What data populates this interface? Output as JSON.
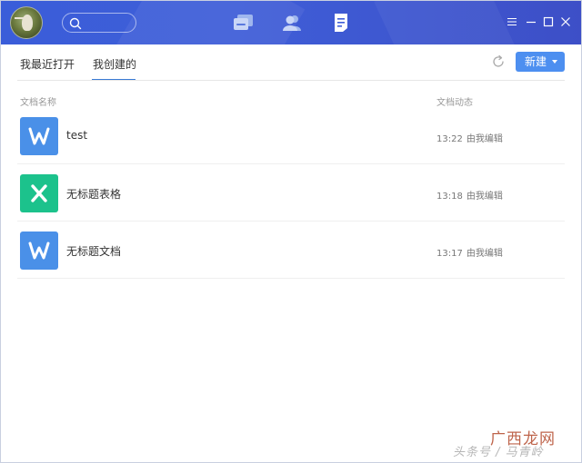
{
  "header": {
    "avatar_icon": "user-avatar-bird",
    "search_icon": "search-icon",
    "nav": [
      {
        "name": "chat",
        "icon": "chat-icon"
      },
      {
        "name": "contacts",
        "icon": "contacts-icon"
      },
      {
        "name": "documents",
        "icon": "document-icon",
        "active": true
      }
    ],
    "window_controls": [
      "menu-icon",
      "minimize-icon",
      "maximize-icon",
      "close-icon"
    ],
    "colors": {
      "header_bg": "#3a5dd9",
      "accent": "#4d8ff0"
    }
  },
  "tabs": [
    {
      "label": "我最近打开",
      "active": false
    },
    {
      "label": "我创建的",
      "active": true
    }
  ],
  "toolbar": {
    "refresh_icon": "refresh-icon",
    "new_button_label": "新建"
  },
  "columns": {
    "name": "文档名称",
    "activity": "文档动态"
  },
  "files": [
    {
      "name": "test",
      "type": "writer",
      "icon_letter": "W",
      "icon_color": "#4a90e8",
      "time": "13:22",
      "activity": "由我编辑"
    },
    {
      "name": "无标题表格",
      "type": "spreadsheet",
      "icon_letter": "X",
      "icon_color": "#1cc28c",
      "time": "13:18",
      "activity": "由我编辑"
    },
    {
      "name": "无标题文档",
      "type": "writer",
      "icon_letter": "W",
      "icon_color": "#4a90e8",
      "time": "13:17",
      "activity": "由我编辑"
    }
  ],
  "watermark": {
    "line1": "广西龙网",
    "line2": "头条号 / 马青岭"
  }
}
